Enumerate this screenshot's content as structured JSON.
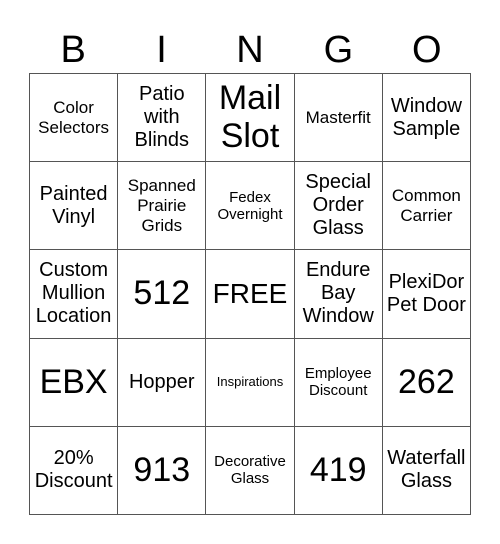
{
  "header": [
    "B",
    "I",
    "N",
    "G",
    "O"
  ],
  "cells": [
    {
      "text": "Color Selectors",
      "size": "sm"
    },
    {
      "text": "Patio with Blinds",
      "size": "m"
    },
    {
      "text": "Mail Slot",
      "size": "xl"
    },
    {
      "text": "Masterfit",
      "size": "sm"
    },
    {
      "text": "Window Sample",
      "size": "m"
    },
    {
      "text": "Painted Vinyl",
      "size": "m"
    },
    {
      "text": "Spanned Prairie Grids",
      "size": "sm"
    },
    {
      "text": "Fedex Overnight",
      "size": "s"
    },
    {
      "text": "Special Order Glass",
      "size": "m"
    },
    {
      "text": "Common Carrier",
      "size": "sm"
    },
    {
      "text": "Custom Mullion Location",
      "size": "m"
    },
    {
      "text": "512",
      "size": "xl"
    },
    {
      "text": "FREE",
      "size": "l"
    },
    {
      "text": "Endure Bay Window",
      "size": "m"
    },
    {
      "text": "PlexiDor Pet Door",
      "size": "m"
    },
    {
      "text": "EBX",
      "size": "xl"
    },
    {
      "text": "Hopper",
      "size": "m"
    },
    {
      "text": "Inspirations",
      "size": "xs"
    },
    {
      "text": "Employee Discount",
      "size": "s"
    },
    {
      "text": "262",
      "size": "xl"
    },
    {
      "text": "20% Discount",
      "size": "m"
    },
    {
      "text": "913",
      "size": "xl"
    },
    {
      "text": "Decorative Glass",
      "size": "s"
    },
    {
      "text": "419",
      "size": "xl"
    },
    {
      "text": "Waterfall Glass",
      "size": "m"
    }
  ]
}
